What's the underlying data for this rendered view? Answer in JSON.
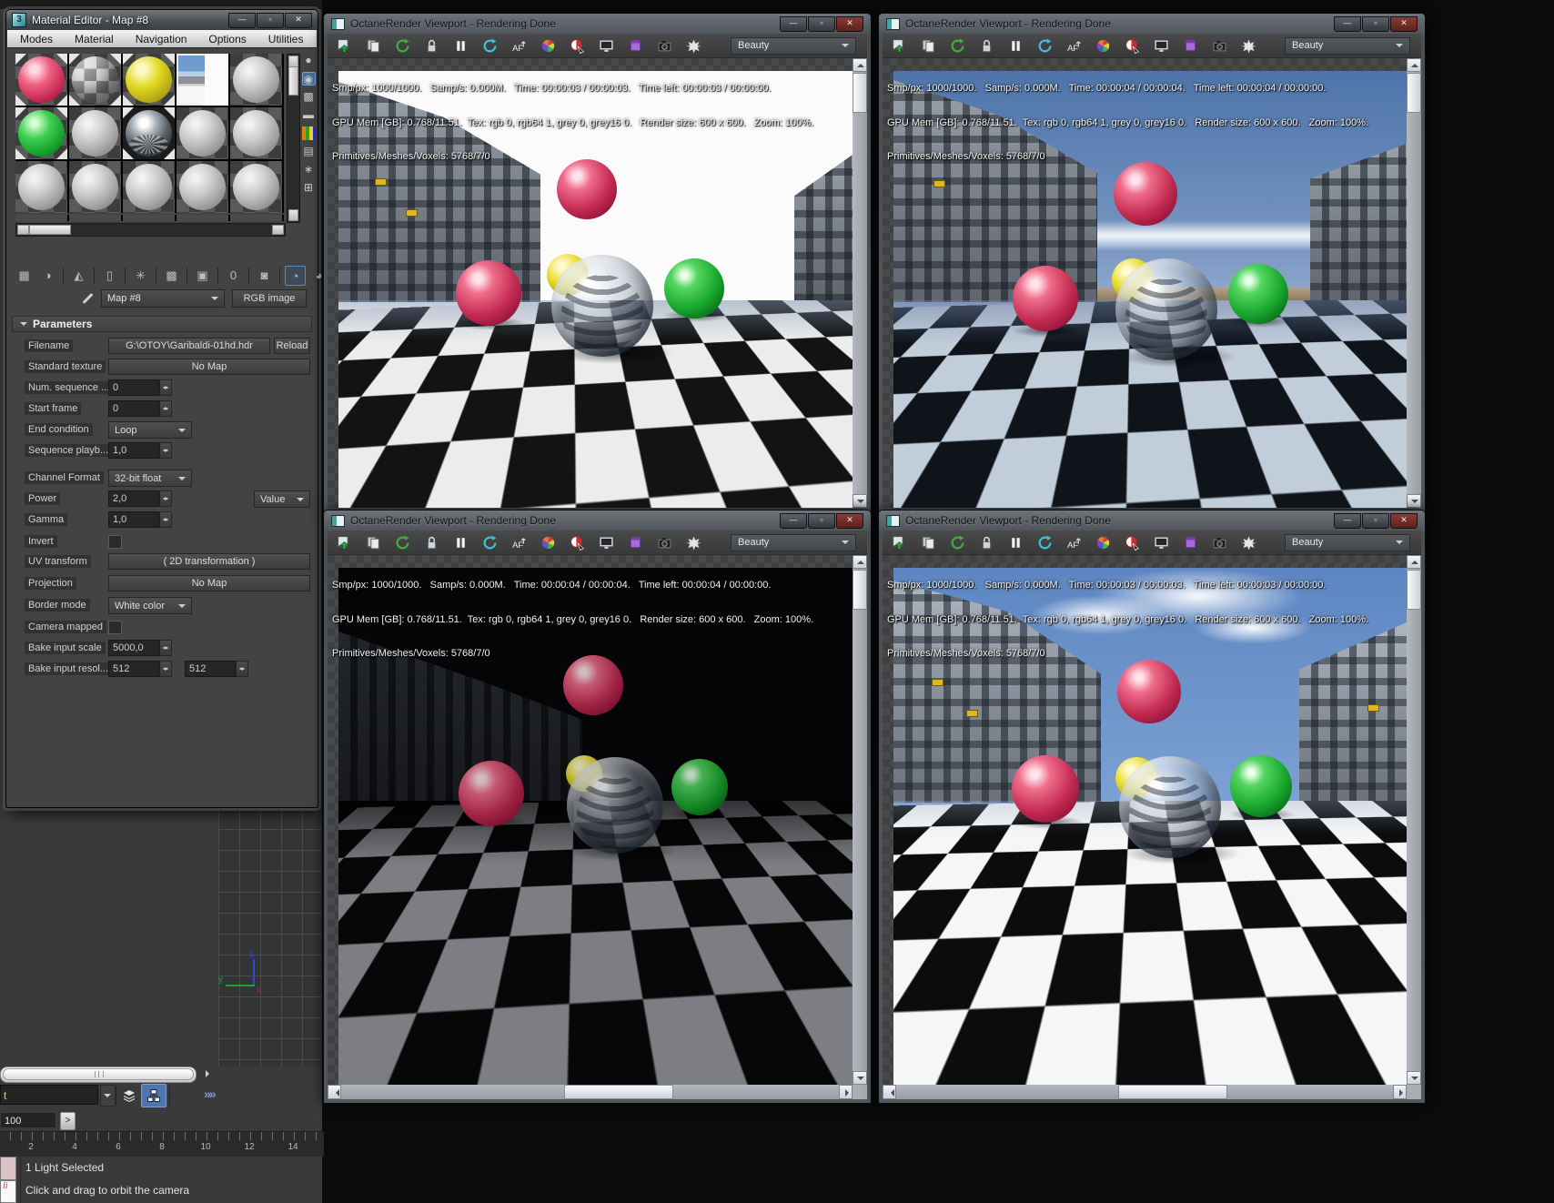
{
  "colors": {
    "ball_pink": "#c22a51",
    "ball_green": "#17a52c",
    "ball_yellow": "#e0d820",
    "sky_blue": "#7795c2",
    "floor_light": "#ececec",
    "floor_dark": "#131313",
    "selection_blue": "#4e76ac",
    "ui_gray": "#3a3a3a"
  },
  "material_editor": {
    "title": "Material Editor - Map #8",
    "app_icon": "3",
    "window_buttons": {
      "minimize": "—",
      "maximize": "▫",
      "close": "✕"
    },
    "menus": [
      "Modes",
      "Material",
      "Navigation",
      "Options",
      "Utilities"
    ],
    "swatch_slots": [
      "pink-sphere",
      "checker-sphere",
      "yellow-sphere",
      "hdr-image-selected",
      "gray-sphere",
      "green-sphere",
      "gray-sphere",
      "glass-sphere",
      "gray-sphere",
      "gray-sphere",
      "gray-sphere",
      "gray-sphere",
      "gray-sphere",
      "gray-sphere",
      "gray-sphere"
    ],
    "side_toolbar_icons": [
      "sample-type-icon",
      "backlight-icon",
      "background-icon",
      "sample-tiling-icon",
      "video-color-check-icon",
      "make-preview-icon",
      "options-icon",
      "select-by-material-icon"
    ],
    "toolbar_icons": [
      "get-material-icon",
      "put-material-icon",
      "assign-material-icon",
      "reset-map-icon",
      "make-unique-icon",
      "put-to-library-icon",
      "save-icon",
      "material-id-icon",
      "show-background-icon",
      "pick-material-icon",
      "uv-sample-icon",
      "material-type-icon"
    ],
    "sample_name": "Map #8",
    "type_button": "RGB image",
    "rollout_title": "Parameters",
    "params": {
      "filename": {
        "label": "Filename",
        "value": "G:\\OTOY\\Garibaldi-01hd.hdr",
        "button": "Reload"
      },
      "standard_texture": {
        "label": "Standard texture",
        "value": "No Map"
      },
      "num_sequence": {
        "label": "Num. sequence ...",
        "value": "0"
      },
      "start_frame": {
        "label": "Start frame",
        "value": "0"
      },
      "end_condition": {
        "label": "End condition",
        "value": "Loop"
      },
      "sequence_playback": {
        "label": "Sequence playb...",
        "value": "1,0"
      },
      "channel_format": {
        "label": "Channel Format",
        "value": "32-bit float"
      },
      "power": {
        "label": "Power",
        "value": "2,0",
        "mode": "Value"
      },
      "gamma": {
        "label": "Gamma",
        "value": "1,0"
      },
      "invert": {
        "label": "Invert",
        "checked": false
      },
      "uv_transform": {
        "label": "UV transform",
        "value": "( 2D transformation )"
      },
      "projection": {
        "label": "Projection",
        "value": "No Map"
      },
      "border_mode": {
        "label": "Border mode",
        "value": "White color"
      },
      "camera_mapped": {
        "label": "Camera mapped",
        "checked": false
      },
      "bake_input_scale": {
        "label": "Bake input scale",
        "value": "5000,0"
      },
      "bake_input_resolution": {
        "label": "Bake input resol...",
        "value1": "512",
        "value2": "512"
      }
    }
  },
  "viewport_toolbar_icons": [
    "save-render-icon",
    "copy-clipboard-icon",
    "restart-render-icon",
    "lock-thumbnails-icon",
    "pause-render-icon",
    "refresh-render-icon",
    "autofocus-picker-icon",
    "white-balance-icon",
    "material-picker-icon",
    "viewport-lock-icon",
    "render-passes-icon",
    "camera-icon",
    "octane-logo-icon"
  ],
  "viewports": {
    "tl": {
      "title": "OctaneRender Viewport - Rendering Done",
      "display_mode": "Beauty",
      "stats1": "Smp/px: 1000/1000.   Samp/s: 0.000M.   Time: 00:00:03 / 00:00:03.   Time left: 00:00:03 / 00:00:00.",
      "stats2": "GPU Mem [GB]: 0.768/11.51.  Tex: rgb 0, rgb64 1, grey 0, grey16 0.   Render size: 600 x 600.   Zoom: 100%.",
      "stats3": "Primitives/Meshes/Voxels: 5768/7/0"
    },
    "tr": {
      "title": "OctaneRender Viewport - Rendering Done",
      "display_mode": "Beauty",
      "stats1": "Smp/px: 1000/1000.   Samp/s: 0.000M.   Time: 00:00:04 / 00:00:04.   Time left: 00:00:04 / 00:00:00.",
      "stats2": "GPU Mem [GB]: 0.768/11.51.  Tex: rgb 0, rgb64 1, grey 0, grey16 0.   Render size: 600 x 600.   Zoom: 100%.",
      "stats3": "Primitives/Meshes/Voxels: 5768/7/0"
    },
    "bl": {
      "title": "OctaneRender Viewport - Rendering Done",
      "display_mode": "Beauty",
      "stats1": "Smp/px: 1000/1000.   Samp/s: 0.000M.   Time: 00:00:04 / 00:00:04.   Time left: 00:00:04 / 00:00:00.",
      "stats2": "GPU Mem [GB]: 0.768/11.51.  Tex: rgb 0, rgb64 1, grey 0, grey16 0.   Render size: 600 x 600.   Zoom: 100%.",
      "stats3": "Primitives/Meshes/Voxels: 5768/7/0"
    },
    "br": {
      "title": "OctaneRender Viewport - Rendering Done",
      "display_mode": "Beauty",
      "stats1": "Smp/px: 1000/1000.   Samp/s: 0.000M.   Time: 00:00:03 / 00:00:03.   Time left: 00:00:03 / 00:00:00.",
      "stats2": "GPU Mem [GB]: 0.768/11.51.  Tex: rgb 0, rgb64 1, grey 0, grey16 0.   Render size: 600 x 600.   Zoom: 100%.",
      "stats3": "Primitives/Meshes/Voxels: 5768/7/0"
    }
  },
  "bottom_ui": {
    "selection_field_value": "t",
    "frame_field_value": "100",
    "go_button": ">",
    "timeline_numbers": [
      "2",
      "4",
      "6",
      "8",
      "10",
      "12",
      "14"
    ],
    "status_line1": "1 Light Selected",
    "status_line2": "Click and drag to orbit the camera",
    "mini_listener_text": "li"
  }
}
